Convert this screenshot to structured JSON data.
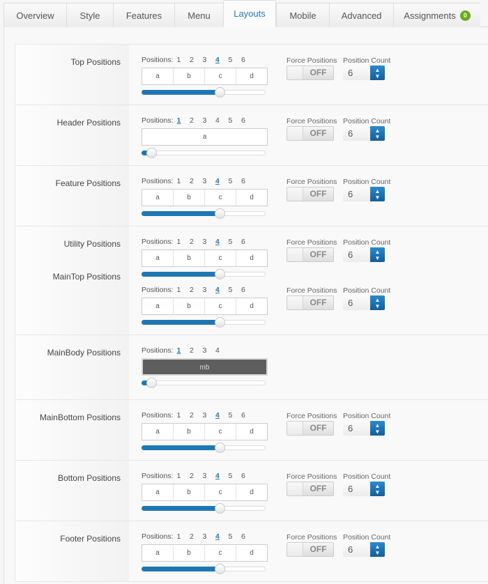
{
  "tabs": [
    {
      "label": "Overview",
      "active": false
    },
    {
      "label": "Style",
      "active": false
    },
    {
      "label": "Features",
      "active": false
    },
    {
      "label": "Menu",
      "active": false
    },
    {
      "label": "Layouts",
      "active": true
    },
    {
      "label": "Mobile",
      "active": false
    },
    {
      "label": "Advanced",
      "active": false
    },
    {
      "label": "Assignments",
      "active": false,
      "badge": "0"
    }
  ],
  "common": {
    "positions_label": "Positions:",
    "force_positions_label": "Force Positions",
    "force_positions_value": "OFF",
    "position_count_label": "Position Count"
  },
  "rows": [
    {
      "label": "Top Positions",
      "groups": [
        {
          "options": [
            "1",
            "2",
            "3",
            "4",
            "5",
            "6"
          ],
          "selected": "4",
          "cells": [
            "a",
            "b",
            "c",
            "d"
          ],
          "slider_fraction": 0.6,
          "force": true,
          "count": "6"
        }
      ]
    },
    {
      "label": "Header Positions",
      "groups": [
        {
          "options": [
            "1",
            "2",
            "3",
            "4",
            "5",
            "6"
          ],
          "selected": "1",
          "cells": [
            "a"
          ],
          "slider_fraction": 0.05,
          "force": true,
          "count": "6"
        }
      ]
    },
    {
      "label": "Feature Positions",
      "groups": [
        {
          "options": [
            "1",
            "2",
            "3",
            "4",
            "5",
            "6"
          ],
          "selected": "4",
          "cells": [
            "a",
            "b",
            "c",
            "d"
          ],
          "slider_fraction": 0.6,
          "force": true,
          "count": "6"
        }
      ]
    },
    {
      "label": "Utility Positions",
      "groups": [
        {
          "options": [
            "1",
            "2",
            "3",
            "4",
            "5",
            "6"
          ],
          "selected": "4",
          "cells": [
            "a",
            "b",
            "c",
            "d"
          ],
          "slider_fraction": 0.6,
          "force": true,
          "count": "6"
        },
        {
          "sublabel": "MainTop Positions",
          "options": [
            "1",
            "2",
            "3",
            "4",
            "5",
            "6"
          ],
          "selected": "4",
          "cells": [
            "a",
            "b",
            "c",
            "d"
          ],
          "slider_fraction": 0.6,
          "force": true,
          "count": "6"
        }
      ]
    },
    {
      "label": "MainBody Positions",
      "groups": [
        {
          "options": [
            "1",
            "2",
            "3",
            "4"
          ],
          "selected": "1",
          "cells": [
            "mb"
          ],
          "dark": true,
          "slider_fraction": 0.05,
          "force": false
        }
      ]
    },
    {
      "label": "MainBottom Positions",
      "groups": [
        {
          "options": [
            "1",
            "2",
            "3",
            "4",
            "5",
            "6"
          ],
          "selected": "4",
          "cells": [
            "a",
            "b",
            "c",
            "d"
          ],
          "slider_fraction": 0.6,
          "force": true,
          "count": "6"
        }
      ]
    },
    {
      "label": "Bottom Positions",
      "groups": [
        {
          "options": [
            "1",
            "2",
            "3",
            "4",
            "5",
            "6"
          ],
          "selected": "4",
          "cells": [
            "a",
            "b",
            "c",
            "d"
          ],
          "slider_fraction": 0.6,
          "force": true,
          "count": "6"
        }
      ]
    },
    {
      "label": "Footer Positions",
      "groups": [
        {
          "options": [
            "1",
            "2",
            "3",
            "4",
            "5",
            "6"
          ],
          "selected": "4",
          "cells": [
            "a",
            "b",
            "c",
            "d"
          ],
          "slider_fraction": 0.6,
          "force": true,
          "count": "6"
        }
      ]
    }
  ]
}
